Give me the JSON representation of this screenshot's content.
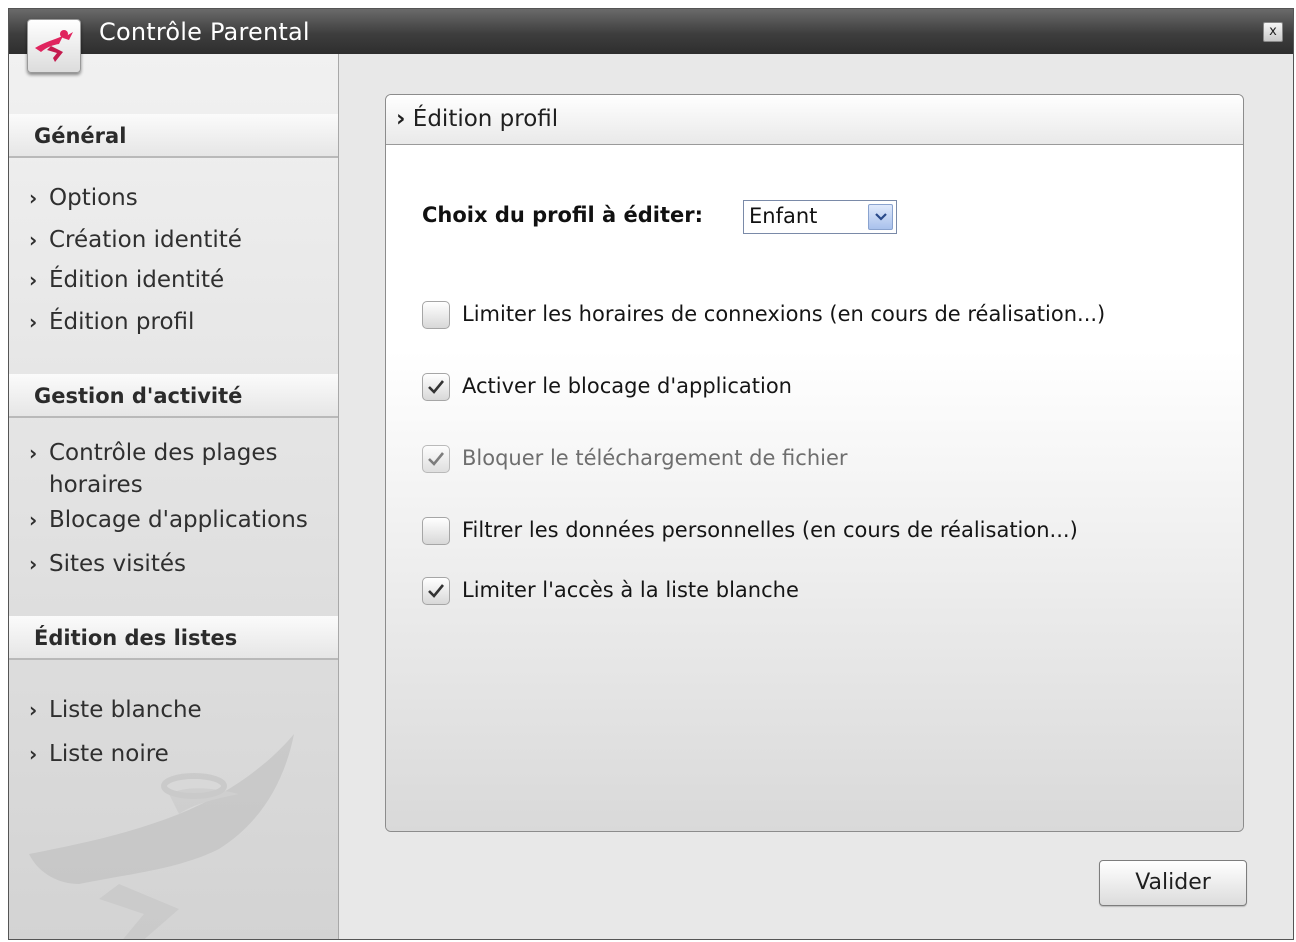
{
  "window": {
    "title": "Contrôle Parental",
    "close_label": "x"
  },
  "sidebar": {
    "sections": [
      {
        "header": "Général",
        "items": [
          {
            "label": "Options"
          },
          {
            "label": "Création identité"
          },
          {
            "label": "Édition identité"
          },
          {
            "label": "Édition profil"
          }
        ]
      },
      {
        "header": "Gestion d'activité",
        "items": [
          {
            "label": "Contrôle des plages horaires"
          },
          {
            "label": "Blocage d'applications"
          },
          {
            "label": "Sites visités"
          }
        ]
      },
      {
        "header": "Édition des listes",
        "items": [
          {
            "label": "Liste blanche"
          },
          {
            "label": "Liste noire"
          }
        ]
      }
    ]
  },
  "panel": {
    "title": "Édition profil",
    "profile_label": "Choix du profil à éditer:",
    "profile_value": "Enfant",
    "options": [
      {
        "label": "Limiter les horaires de connexions (en cours de réalisation...)",
        "checked": false,
        "enabled": true
      },
      {
        "label": "Activer le blocage d'application",
        "checked": true,
        "enabled": true
      },
      {
        "label": "Bloquer le téléchargement de fichier",
        "checked": true,
        "enabled": false
      },
      {
        "label": "Filtrer les données personnelles (en cours de réalisation...)",
        "checked": false,
        "enabled": true
      },
      {
        "label": "Limiter l'accès à la liste blanche",
        "checked": true,
        "enabled": true
      }
    ]
  },
  "footer": {
    "submit_label": "Valider"
  },
  "colors": {
    "titlebar": "#3e3e3e",
    "logo_accent": "#e0245e",
    "select_arrow": "#a9c1ec"
  }
}
